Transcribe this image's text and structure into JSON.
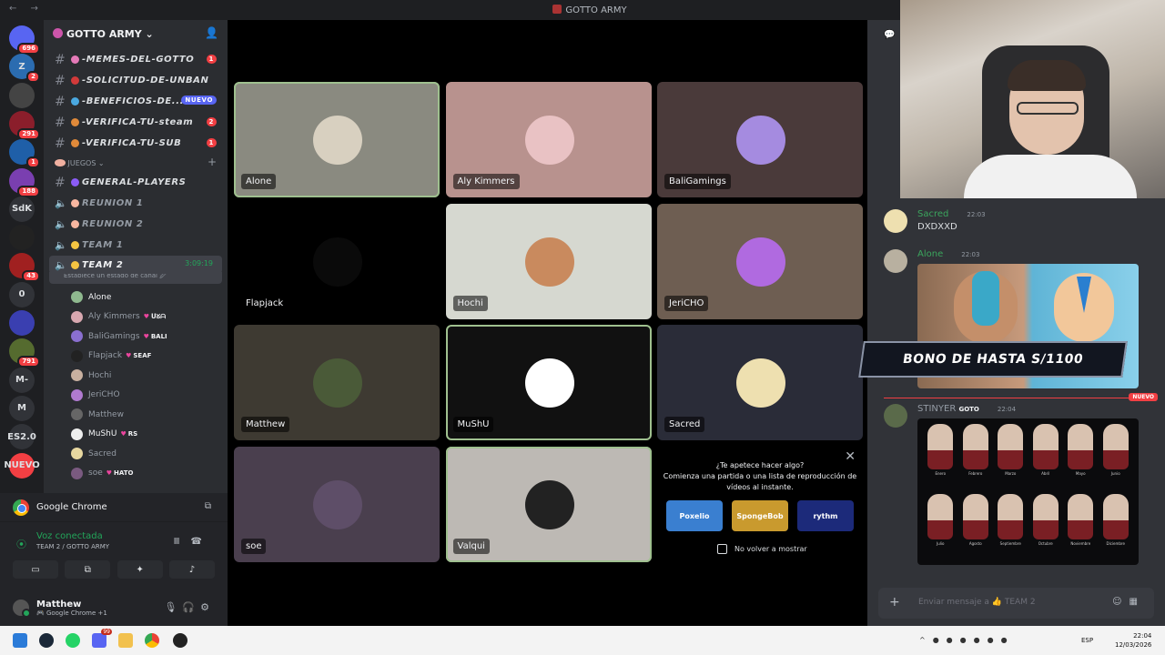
{
  "window": {
    "title": "GOTTO ARMY",
    "nav": "← →"
  },
  "servers": [
    {
      "label": "",
      "icon": "discord-icon",
      "badge": "696",
      "color": "#5865f2"
    },
    {
      "label": "Z",
      "icon": "server-z-icon",
      "badge": "2",
      "color": "#2b6cb0"
    },
    {
      "label": "",
      "icon": "server-icon",
      "badge": "",
      "color": "#444"
    },
    {
      "label": "",
      "icon": "server-icon",
      "badge": "291",
      "color": "#8b1e2b"
    },
    {
      "label": "",
      "icon": "server-icon",
      "badge": "1",
      "color": "#1f5fa8"
    },
    {
      "label": "",
      "icon": "server-icon",
      "badge": "188",
      "color": "#7a3fb0"
    },
    {
      "label": "SdK",
      "icon": "server-sdk-icon",
      "badge": "",
      "color": "#313338"
    },
    {
      "label": "",
      "icon": "server-division-icon",
      "badge": "",
      "color": "#222"
    },
    {
      "label": "",
      "icon": "server-icon",
      "badge": "43",
      "color": "#a02020"
    },
    {
      "label": "0",
      "icon": "server-0-icon",
      "badge": "",
      "color": "#313338"
    },
    {
      "label": "",
      "icon": "server-icon",
      "badge": "",
      "color": "#3a3fb0"
    },
    {
      "label": "",
      "icon": "server-icon",
      "badge": "791",
      "color": "#556b2f"
    },
    {
      "label": "M-",
      "icon": "server-m-icon",
      "badge": "",
      "color": "#313338"
    },
    {
      "label": "M",
      "icon": "server-m2-icon",
      "badge": "",
      "color": "#313338"
    },
    {
      "label": "ES2.0",
      "icon": "server-es-icon",
      "badge": "",
      "color": "#313338"
    },
    {
      "label": "NUEVO",
      "icon": "server-new-icon",
      "badge": "",
      "color": "#f23f43"
    }
  ],
  "guild": {
    "name": "GOTTO ARMY ⌄"
  },
  "channels": [
    {
      "name": "-MEMES-DEL-GOTTO",
      "badge": "1",
      "emoji": "#e57ab8"
    },
    {
      "name": "-SOLICITUD-DE-UNBAN",
      "badge": "",
      "emoji": "#d23a3a"
    },
    {
      "name": "-BENEFICIOS-DE...",
      "badge": "",
      "nuevo": "NUEVO",
      "emoji": "#4aa8e0"
    },
    {
      "name": "-VERIFICA-TU-steam",
      "badge": "2",
      "emoji": "#e08a3a"
    },
    {
      "name": "-VERIFICA-TU-SUB",
      "badge": "1",
      "emoji": "#e08a3a"
    }
  ],
  "category": {
    "name": "JUEGOS ⌄",
    "emoji": "#f0b0a0"
  },
  "voice_channels": [
    {
      "name": "GENERAL-PLAYERS",
      "kind": "text",
      "emoji": "#8b5cf6"
    },
    {
      "name": "REUNION 1",
      "kind": "voice",
      "emoji": "#f7b6a0"
    },
    {
      "name": "REUNION 2",
      "kind": "voice",
      "emoji": "#f7b6a0"
    },
    {
      "name": "TEAM 1",
      "kind": "voice",
      "emoji": "#f5c542"
    },
    {
      "name": "TEAM 2",
      "kind": "voice",
      "emoji": "#f5c542",
      "timer": "3:09:19",
      "active": true
    }
  ],
  "active_status": "Establece un estado de canal 🖉",
  "members": [
    {
      "name": "Alone",
      "tag": "",
      "live": true,
      "color": "#8fb98f"
    },
    {
      "name": "Aly Kimmers",
      "tag": "ᑌᘜᗩ",
      "color": "#d8a8b0"
    },
    {
      "name": "BaliGamings",
      "tag": "BALI",
      "color": "#8a6fd0"
    },
    {
      "name": "Flapjack",
      "tag": "SEAF",
      "color": "#222"
    },
    {
      "name": "Hochi",
      "tag": "",
      "color": "#c8b0a0"
    },
    {
      "name": "JeriCHO",
      "tag": "",
      "color": "#b07ad0"
    },
    {
      "name": "Matthew",
      "tag": "",
      "color": "#666"
    },
    {
      "name": "MuShU",
      "tag": "RS",
      "live": true,
      "color": "#eee"
    },
    {
      "name": "Sacred",
      "tag": "",
      "color": "#e8d8a0"
    },
    {
      "name": "soe",
      "tag": "HATO",
      "color": "#7a5a80"
    }
  ],
  "app_activity": {
    "name": "Google Chrome"
  },
  "voice_status": {
    "title": "Voz conectada",
    "subtitle": "TEAM 2 / GOTTO ARMY"
  },
  "user": {
    "name": "Matthew",
    "activity": "🎮 Google Chrome +1"
  },
  "tiles": [
    {
      "name": "Alone",
      "bg": "#8a8a80",
      "ava": "#d8d0c0",
      "speaking": true
    },
    {
      "name": "Aly Kimmers",
      "bg": "#b8928e",
      "ava": "#e9c2c4"
    },
    {
      "name": "BaliGamings",
      "bg": "#4a3a3a",
      "ava": "#a58be0"
    },
    {
      "name": "Flapjack",
      "bg": "#000000",
      "ava": "#0a0a0a",
      "noframe": true
    },
    {
      "name": "Hochi",
      "bg": "#d6d8d0",
      "ava": "#c98a5e"
    },
    {
      "name": "JeriCHO",
      "bg": "#6e5e52",
      "ava": "#b06ae0"
    },
    {
      "name": "Matthew",
      "bg": "#3e3a32",
      "ava": "#4a5a38"
    },
    {
      "name": "MuShU",
      "bg": "#111111",
      "ava": "#ffffff",
      "speaking": true
    },
    {
      "name": "Sacred",
      "bg": "#2a2c38",
      "ava": "#eee0b0"
    },
    {
      "name": "soe",
      "bg": "#4a3f4e",
      "ava": "#5e4e68"
    },
    {
      "name": "Valqui",
      "bg": "#bdb9b4",
      "ava": "#222222",
      "speaking": true
    }
  ],
  "activity_prompt": {
    "question": "¿Te apetece hacer algo?",
    "body": "Comienza una partida o una lista de reproducción de vídeos al instante.",
    "games": [
      {
        "label": "Poxelio",
        "color": "#3a7fd0"
      },
      {
        "label": "SpongeBob",
        "color": "#c99a2e"
      },
      {
        "label": "rythm",
        "color": "#1c2a7a"
      }
    ],
    "checkbox": "No volver a mostrar"
  },
  "chat": {
    "messages": [
      {
        "author": "Sacred",
        "time": "22:03",
        "text": "DXDXXD",
        "color": "#3ba55d",
        "av": "#eee0b0"
      },
      {
        "author": "Alone",
        "time": "22:03",
        "text": "",
        "color": "#3ba55d",
        "av": "#d8d0c0"
      },
      {
        "author": "STINYER",
        "time": "22:04",
        "text": "",
        "color": "#949ba4",
        "tag": "GOTO",
        "av": "#5a6a4a"
      }
    ],
    "promo_banner": "BONO DE HASTA S/1100",
    "new_divider": "NUEVO",
    "months": [
      "Enero",
      "Febrero",
      "Marzo",
      "Abril",
      "Mayo",
      "Junio",
      "Julio",
      "Agosto",
      "Septiembre",
      "Octubre",
      "Noviembre",
      "Diciembre"
    ],
    "composer_placeholder": "Enviar mensaje a 👍 TEAM 2"
  },
  "taskbar": {
    "lang": "ESP",
    "time": "22:04",
    "date": "12/03/2026",
    "discord_badge": "99"
  }
}
